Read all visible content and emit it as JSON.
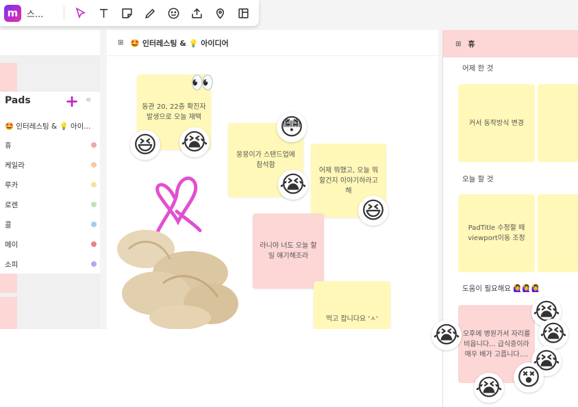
{
  "app": {
    "logo_text": "m",
    "title": "스..."
  },
  "toolbar": {
    "tools": [
      {
        "name": "select-tool",
        "icon": "cursor-icon"
      },
      {
        "name": "text-tool",
        "icon": "text-icon"
      },
      {
        "name": "sticky-note-tool",
        "icon": "sticky-note-icon"
      },
      {
        "name": "pen-tool",
        "icon": "pen-icon"
      },
      {
        "name": "emoji-tool",
        "icon": "smiley-icon"
      },
      {
        "name": "upload-tool",
        "icon": "upload-icon"
      },
      {
        "name": "location-tool",
        "icon": "location-pin-icon"
      },
      {
        "name": "layout-tool",
        "icon": "layout-icon"
      }
    ],
    "accent": "#c226c4"
  },
  "pads": {
    "title": "Pads",
    "add_label": "+",
    "collapse_label": "«",
    "items": [
      {
        "label": "🤩 인터레스팅 & 💡 아이...",
        "color": null
      },
      {
        "label": "휴",
        "color": "#f2a7a7"
      },
      {
        "label": "케일라",
        "color": "#f8c9a0"
      },
      {
        "label": "루카",
        "color": "#f6e39a"
      },
      {
        "label": "로렌",
        "color": "#bfe3b4"
      },
      {
        "label": "콜",
        "color": "#9fcdf0"
      },
      {
        "label": "메이",
        "color": "#e98383"
      },
      {
        "label": "소피",
        "color": "#b7a6f0"
      }
    ]
  },
  "board": {
    "title": "🤩 인터레스팅 & 💡 아이디어",
    "notes": [
      {
        "text": "동관 20, 22층 확진자 발생으로 오늘 재택",
        "color": "yellow"
      },
      {
        "text": "뭉뭉이가 스탠드업에 참석함",
        "color": "yellow"
      },
      {
        "text": "어제 뭐했고, 오늘 뭐 할건지 이야기하라고 해",
        "color": "yellow"
      },
      {
        "text": "라니야 너도 오늘 할일 얘기해조라",
        "color": "pink"
      },
      {
        "text": "먹고 잡니다요 'ㅅ'",
        "color": "yellow"
      }
    ]
  },
  "right": {
    "title": "휴",
    "sections": [
      {
        "label": "어제 한 것",
        "notes": [
          "커서 동작방식 변경",
          ""
        ]
      },
      {
        "label": "오늘 할 것",
        "notes": [
          "PadTitle 수정할 때 viewport이동 조정",
          ""
        ]
      },
      {
        "label": "도움이 필요해요 🙋‍♀️🙋‍♀️🙋‍♀️",
        "notes": [
          "오후에 병원가서 자리를 비웁니다... 급식중이라 매우 배가 고픕니다...."
        ]
      }
    ]
  }
}
